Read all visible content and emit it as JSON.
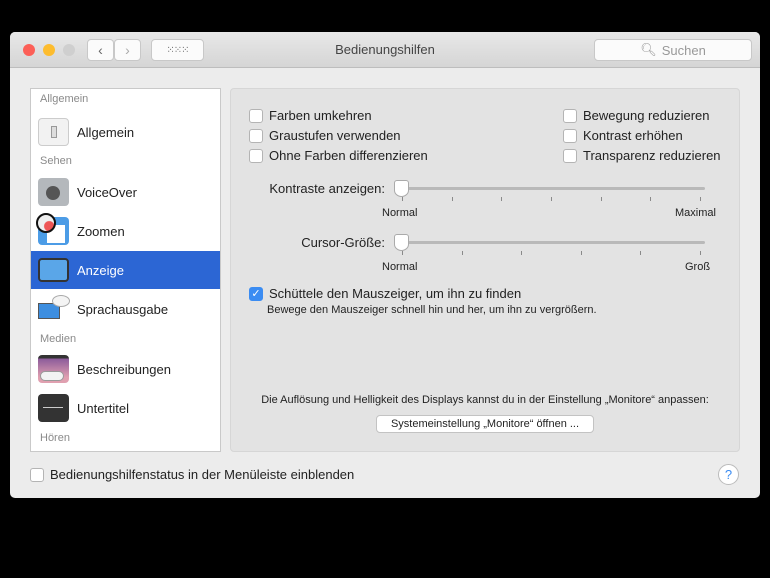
{
  "window": {
    "title": "Bedienungshilfen",
    "search_placeholder": "Suchen"
  },
  "sidebar": {
    "sections": [
      "Allgemein",
      "Sehen",
      "Medien",
      "Hören"
    ],
    "items": [
      {
        "label": "Allgemein",
        "icon": "switch-icon"
      },
      {
        "label": "VoiceOver",
        "icon": "voiceover-icon"
      },
      {
        "label": "Zoomen",
        "icon": "zoom-icon"
      },
      {
        "label": "Anzeige",
        "icon": "display-icon",
        "selected": true
      },
      {
        "label": "Sprachausgabe",
        "icon": "speech-icon"
      },
      {
        "label": "Beschreibungen",
        "icon": "descriptions-icon"
      },
      {
        "label": "Untertitel",
        "icon": "captions-icon"
      }
    ]
  },
  "display": {
    "checkboxes": [
      {
        "label": "Farben umkehren",
        "checked": false
      },
      {
        "label": "Graustufen verwenden",
        "checked": false
      },
      {
        "label": "Ohne Farben differenzieren",
        "checked": false
      },
      {
        "label": "Bewegung reduzieren",
        "checked": false
      },
      {
        "label": "Kontrast erhöhen",
        "checked": false
      },
      {
        "label": "Transparenz reduzieren",
        "checked": false
      }
    ],
    "contrast": {
      "label": "Kontraste anzeigen:",
      "min_label": "Normal",
      "max_label": "Maximal",
      "value": 0
    },
    "cursor": {
      "label": "Cursor-Größe:",
      "min_label": "Normal",
      "max_label": "Groß",
      "value": 0
    },
    "shake": {
      "label": "Schüttele den Mauszeiger, um ihn zu finden",
      "checked": true,
      "description": "Bewege den Mauszeiger schnell hin und her, um ihn zu vergrößern."
    },
    "monitor_note": "Die Auflösung und Helligkeit des Displays kannst du in der Einstellung „Monitore“ anpassen:",
    "monitor_button": "Systemeinstellung „Monitore“ öffnen ..."
  },
  "footer": {
    "status_label": "Bedienungshilfenstatus in der Menüleiste einblenden",
    "status_checked": false,
    "help": "?"
  }
}
